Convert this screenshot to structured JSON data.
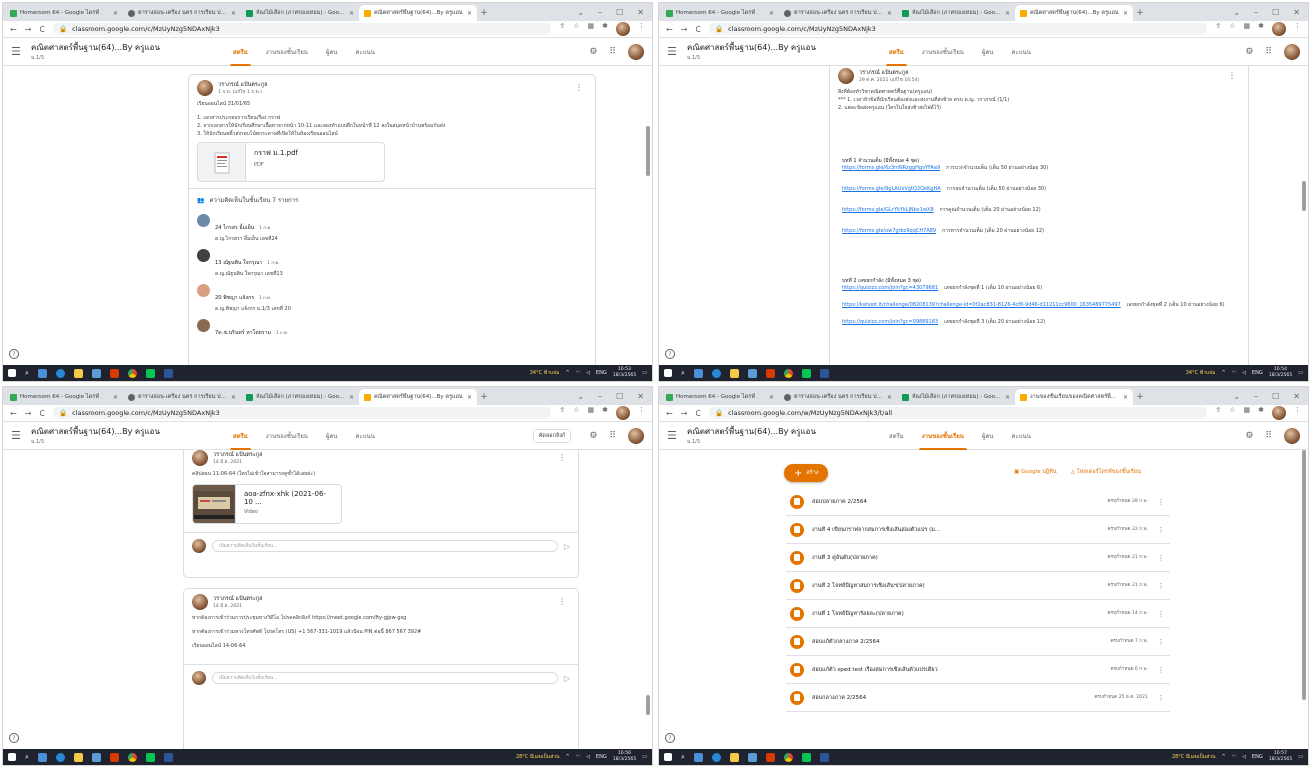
{
  "browser": {
    "tabs": [
      {
        "label": "Homeroom 64 - Google ไดรฟ์",
        "color": "#34a853"
      },
      {
        "label": "ตารางสอน-เครื่อง นคร การเรียน ปก.1",
        "color": "#5f6368"
      },
      {
        "label": "ห้องไม้เลือก (ภาคของเทอม) - Google",
        "color": "#0f9d58"
      }
    ],
    "active_tab_stream": "คณิตศาสตร์พื้นฐาน(64)...By ครูแอน",
    "active_tab_classwork": "งานของชั้นเรียนของคณิตศาสตร์พื้...",
    "url_stream": "classroom.google.com/c/MzUyNzg5NDAxNjk3",
    "url_classwork": "classroom.google.com/w/MzUyNzg5NDAxNjk3/t/all",
    "colors": {
      "accent": "#e37400",
      "link": "#1a73e8"
    }
  },
  "classroom": {
    "class_name": "คณิตศาสตร์พื้นฐาน(64)...By ครูแอน",
    "section": "ม.1/3",
    "nav": [
      "สตรีม",
      "งานของชั้นเรียน",
      "ผู้คน",
      "คะแนน"
    ],
    "call_button": "คัดลอกลิงก์"
  },
  "taskbar": {
    "tl": {
      "weather": "34°C ฟ้าแจ่ม",
      "lang": "ENG",
      "time": "16:53",
      "date": "18/3/2565"
    },
    "tr": {
      "weather": "34°C ฟ้าแจ่ม",
      "lang": "ENG",
      "time": "16:54",
      "date": "18/3/2565"
    },
    "bl": {
      "weather": "28°C มีเมฆเป็นส่วน",
      "lang": "ENG",
      "time": "16:56",
      "date": "18/3/2565"
    },
    "br": {
      "weather": "28°C มีเมฆเป็นส่วน",
      "lang": "ENG",
      "time": "16:57",
      "date": "18/3/2565"
    }
  },
  "stream_post_tl": {
    "author": "วราภรณ์ แป้นตระกูล",
    "date": "1 ก.พ. (แก้ไข 1 ก.พ.)",
    "lines": [
      "เรียนออนไลน์ 31/01/65",
      "",
      "1. เอกสารประกอบการเรียนเรื่อง กราฟ",
      "2. จากเอกสารให้นักเรียนศึกษาเนื้อหาจากหน้า 10-11 และลองทำแบบฝึกในหน้าที่ 12 ลงในสมุดหน้าบ้านพร้อมกันส่ง",
      "3. ให้นักเรียนพลิ้วส่งรอบโน้ตกระดาษที่เปิดให้ในห้องเรียนออนไลน์"
    ],
    "attachment": {
      "name": "กราฟ ม.1.pdf",
      "type": "PDF"
    },
    "comments_header": "ความคิดเห็นในชั้นเรียน 7 รายการ",
    "comments": [
      {
        "name": "24 ไกรสร อิ้มเย็น",
        "date": "1 ก.พ.",
        "text": "ด.ญ.ไกรสรา อิ้มเย็น เลขที่24",
        "color": "#6d8aa8"
      },
      {
        "name": "13 ณัฐนพิน ใจกรุณา",
        "date": "1 ก.พ.",
        "text": "ด.ญ.ณัฐนพิน ใจกรุณา เลขที่13",
        "color": "#404040"
      },
      {
        "name": "20 พิชญา แจ้งกร",
        "date": "1 ก.พ.",
        "text": "ด.ญ.พิชญา แจ้งกร ม.1/3 เลขที่ 20",
        "color": "#d9a080"
      },
      {
        "name": "7ด.ช.นรินทร์ หาโดยราม",
        "date": "1 ก.พ.",
        "text": "",
        "color": "#8a6a50"
      }
    ]
  },
  "stream_post_tr": {
    "author": "วราภรณ์ แป้นตระกูล",
    "date": "29 ต.ค. 2021 (แก้ไข 16:54)",
    "lines": [
      "สิ่งที่ต้องทำวิชาคณิตศาสตร์พื้นฐาน(ครูแอน)",
      "*** 1. เวลาหัวข้อที่นักเรียนต้องส่งและส่งงานที่ส่งช้าย ครบ ด.ญ. วราภรณ์ (1/1)",
      "2. แต่ละข้อส่งครูแอน (ใครในใจส่งช้าส่งไฟล์ไว้)"
    ],
    "unit1_title": "บทที่ 1 จำนวนเต็ม (มีทั้งหมด 4 ชุด)",
    "unit1_links": [
      {
        "url": "https://forms.gle/6z3mNRzggHgvYFAa9",
        "note": "การบวกจำนวนเต็ม (เต็ม 50 ผ่านอย่างน้อย 30)"
      },
      {
        "url": "https://forms.gle/9gLAUxVgtQ2QeKgHA",
        "note": "การลบจำนวนเต็ม (เต็ม 50 ผ่านอย่างน้อย 30)"
      },
      {
        "url": "https://forms.gle/GLrYkYkLjNbx1wX8",
        "note": "การคูณจำนวนเต็ม (เต็ม 20 ผ่านอย่างน้อย 12)"
      },
      {
        "url": "https://forms.gle/ow7gtbz9qqCH7A89",
        "note": "การหารจำนวนเต็ม (เต็ม 20 ผ่านอย่างน้อย 12)"
      }
    ],
    "unit2_title": "บทที่ 2 เลขยกกำลัง (มีทั้งหมด 3 ชุด)",
    "unit2_links": [
      {
        "url": "https://quizizz.com/join?gc=43079681",
        "note": "เลขยกกำลังชุดที่ 1 (เต็ม 10 ผ่านอย่างน้อย 6)"
      },
      {
        "url": "https://kahoot.it/challenge/08208139?challenge-id=0f2ac831-8126-4cf8-9d46-d11211cc9600_1635489775497",
        "note": "เลขยกกำลังชุดที่ 2 (เต็ม 10 ผ่านอย่างน้อย 6)"
      },
      {
        "url": "https://quizizz.com/join?gc=09889183",
        "note": "เลขยกกำลังชุดที่ 3 (เต็ม 20 ผ่านอย่างน้อย 12)"
      }
    ]
  },
  "stream_post_bl1": {
    "author": "วราภรณ์ แป้นตระกูล",
    "date": "14 มิ.ย. 2021",
    "text": "คลิปสอน 11-06-64 (ใครไม่เข้าใจสามารถดูซ้ำได้เลยค่ะ)",
    "attachment": {
      "name": "aoa-zfnx-xhk (2021-06-10 ...",
      "type": "Video"
    },
    "reply_placeholder": "เพิ่มความคิดเห็นในชั้นเรียน..."
  },
  "stream_post_bl2": {
    "author": "วราภรณ์ แป้นตระกูล",
    "date": "14 มิ.ย. 2021",
    "lines": [
      "หากต้องการเข้าร่วมการประชุมทางวิดีโอ โปรดคลิกลิงก์ https://meet.google.com/fty-gjpw-gsg",
      "หากต้องการเข้าร่วมทางโทรศัพท์ โปรดโทร (US) +1 567-331-1019 แล้วป้อน PIN ต่อนี้ 867 567 392#",
      "เรียนออนไลน์ 14-06-64"
    ],
    "reply_placeholder": "เพิ่มความคิดเห็นในชั้นเรียน..."
  },
  "classwork": {
    "create_label": "สร้าง",
    "calendar_link": "Google ปฏิทิน",
    "drive_link": "โฟลเดอร์ไดรฟ์ของชั้นเรียน",
    "items": [
      {
        "title": "สอบปลายภาค 2/2564",
        "due": "ครบกำหนด 28 ก.พ."
      },
      {
        "title": "งานที่ 4 เขียนกราฟจากสมการเชิงเส้นสองตัวแปร (ม...",
        "due": "ครบกำหนด 22 ก.พ."
      },
      {
        "title": "งานที่ 3 คู่อันดับ(ปลายภาค)",
        "due": "ครบกำหนด 21 ก.พ."
      },
      {
        "title": "งานที่ 2 โจทย์ปัญหาสมการเชิงเส้นฯ(ปลายภาค)",
        "due": "ครบกำหนด 21 ก.พ."
      },
      {
        "title": "งานที่ 1 โจทย์ปัญหาร้อยละ(ปลายภาค)",
        "due": "ครบกำหนด 14 ก.พ."
      },
      {
        "title": "สอบแก้ตัวกลางภาค 2/2564",
        "due": "ครบกำหนด 7 ก.พ."
      },
      {
        "title": "สอบแก้ตัว sped test เรื่องสมการเชิงเส้นตัวแปรเดียว",
        "due": "ครบกำหนด 6 ก.พ."
      },
      {
        "title": "สอบกลางภาค 2/2564",
        "due": "ครบกำหนด 25 ธ.ค. 2021"
      }
    ]
  }
}
